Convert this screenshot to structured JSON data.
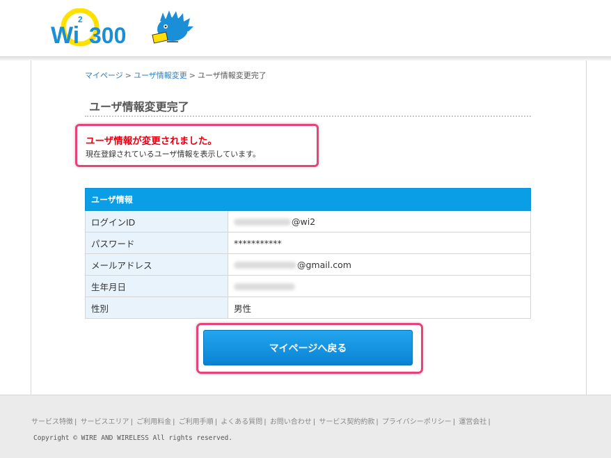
{
  "logo": {
    "brand": "Wi",
    "superscript": "2",
    "number": "300"
  },
  "breadcrumb": [
    {
      "label": "マイページ"
    },
    {
      "label": "ユーザ情報変更"
    },
    {
      "label": "ユーザ情報変更完了"
    }
  ],
  "breadcrumb_sep": ">",
  "page_title": "ユーザ情報変更完了",
  "message": {
    "main": "ユーザ情報が変更されました。",
    "sub": "現在登録されているユーザ情報を表示しています。"
  },
  "table": {
    "header": "ユーザ情報",
    "rows": [
      {
        "label": "ログインID",
        "value": "@wi2"
      },
      {
        "label": "パスワード",
        "value": "***********"
      },
      {
        "label": "メールアドレス",
        "value": "@gmail.com"
      },
      {
        "label": "生年月日",
        "value": ""
      },
      {
        "label": "性別",
        "value": "男性"
      }
    ]
  },
  "back_button": "マイページへ戻る",
  "footer": {
    "links": [
      "サービス特徴",
      "サービスエリア",
      "ご利用料金",
      "ご利用手順",
      "よくある質問",
      "お問い合わせ",
      "サービス契約約款",
      "プライバシーポリシー",
      "運営会社"
    ],
    "copyright": "Copyright © WIRE AND WIRELESS All rights reserved."
  },
  "colors": {
    "accent": "#0a9ee6",
    "highlight": "#e8427c",
    "alert": "#e60012",
    "logo_yellow": "#ffe000",
    "logo_blue": "#1a8fd8"
  },
  "icons": [
    "hedgehog-mascot-icon"
  ]
}
